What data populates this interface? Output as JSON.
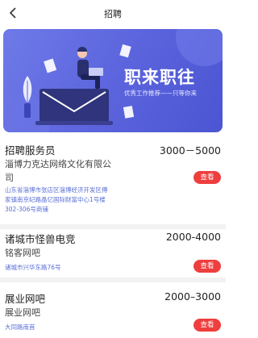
{
  "header": {
    "title": "招聘"
  },
  "banner": {
    "title": "职来职往",
    "subtitle": "优秀工作推荐——只等你来"
  },
  "jobs": [
    {
      "title": "招聘服务员",
      "salary": "3000－5000",
      "company_line1": "淄博力克达网络文化有限公",
      "company_line2": "司",
      "address_line1": "山东省淄博市张店区淄博经济开发区傅",
      "address_line2": "家镇南京纪路晶亿国际财富中心1号楼",
      "address_line3": "302-306号商铺",
      "button": "查看"
    },
    {
      "title": "诸城市怪兽电竞",
      "salary": "2000-4000",
      "company_line1": "铭客网吧",
      "address_line1": "诸城市兴华东路76号",
      "button": "查看"
    },
    {
      "title": "展业网吧",
      "salary": "2000–3000",
      "company_line1": "展业网吧",
      "address_line1": "大同路南首",
      "button": "查看"
    }
  ],
  "colors": {
    "accent_red": "#ee3e3e",
    "banner_blue": "#5a63dc",
    "address_blue": "#5a6fd6"
  },
  "icons": {
    "back": "chevron-left-icon"
  }
}
